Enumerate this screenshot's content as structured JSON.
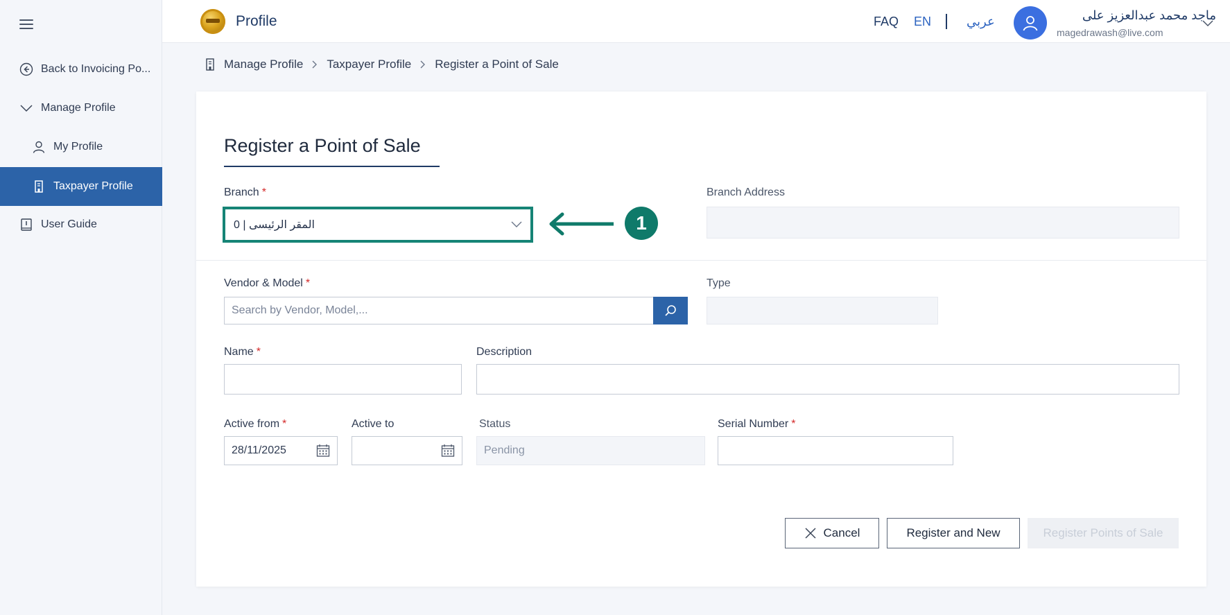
{
  "sidebar": {
    "items": [
      {
        "label": "Back to Invoicing Po..."
      },
      {
        "label": "Manage Profile"
      },
      {
        "label": "My Profile"
      },
      {
        "label": "Taxpayer Profile"
      },
      {
        "label": "User Guide"
      }
    ]
  },
  "header": {
    "title": "Profile",
    "faq": "FAQ",
    "lang_en": "EN",
    "lang_ar": "عربي",
    "user_name": "ماجد محمد عبدالعزيز على",
    "user_email": "magedrawash@live.com"
  },
  "breadcrumb": [
    "Manage Profile",
    "Taxpayer Profile",
    "Register a Point of Sale"
  ],
  "form": {
    "title": "Register a Point of Sale",
    "branch_label": "Branch",
    "branch_value": "المقر الرئيسى | 0",
    "branch_address_label": "Branch Address",
    "branch_address_value": "",
    "vendor_label": "Vendor & Model",
    "vendor_placeholder": "Search by Vendor, Model,...",
    "type_label": "Type",
    "name_label": "Name",
    "description_label": "Description",
    "active_from_label": "Active from",
    "active_from_value": "28/11/2025",
    "active_to_label": "Active to",
    "active_to_value": "",
    "status_label": "Status",
    "status_value": "Pending",
    "serial_label": "Serial Number",
    "required_mark": "*"
  },
  "annotation": {
    "number": "1",
    "color": "#0f7a6a"
  },
  "buttons": {
    "cancel": "Cancel",
    "register_new": "Register and New",
    "register_pos": "Register Points of Sale"
  },
  "colors": {
    "accent": "#2c63a8",
    "highlight": "#168476",
    "required": "#d42a2a"
  }
}
